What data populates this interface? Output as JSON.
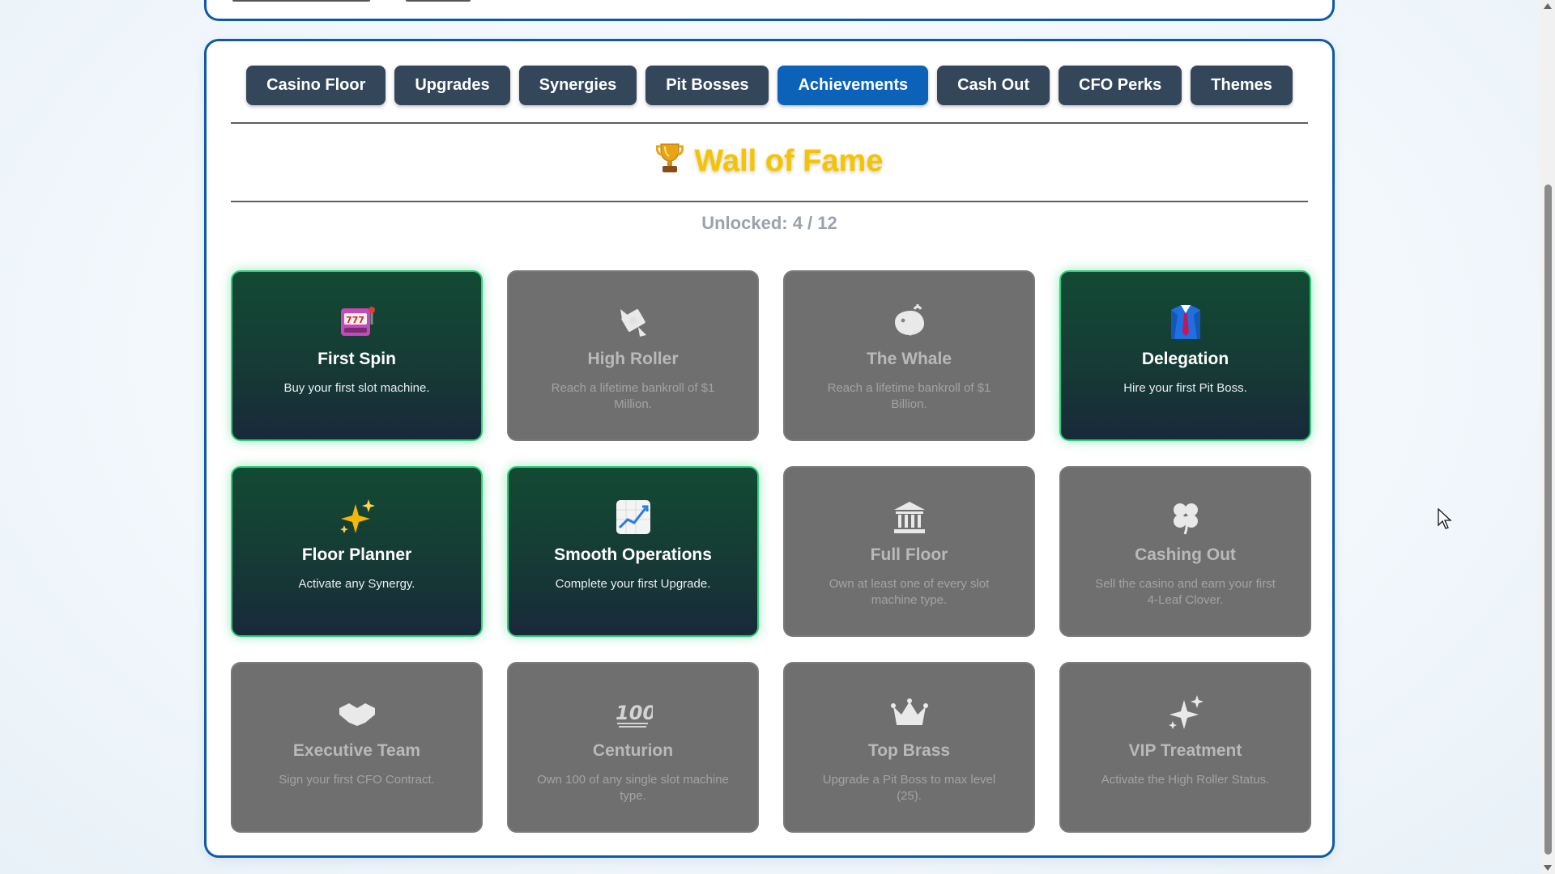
{
  "tabs": [
    {
      "label": "Casino Floor",
      "active": false
    },
    {
      "label": "Upgrades",
      "active": false
    },
    {
      "label": "Synergies",
      "active": false
    },
    {
      "label": "Pit Bosses",
      "active": false
    },
    {
      "label": "Achievements",
      "active": true
    },
    {
      "label": "Cash Out",
      "active": false
    },
    {
      "label": "CFO Perks",
      "active": false
    },
    {
      "label": "Themes",
      "active": false
    }
  ],
  "page": {
    "title": "Wall of Fame",
    "trophy_icon": "trophy-icon",
    "unlocked_text": "Unlocked: 4 / 12"
  },
  "achievements": [
    {
      "title": "First Spin",
      "desc": "Buy your first slot machine.",
      "unlocked": true,
      "icon": "slot-machine-icon"
    },
    {
      "title": "High Roller",
      "desc": "Reach a lifetime bankroll of $1 Million.",
      "unlocked": false,
      "icon": "money-wings-icon"
    },
    {
      "title": "The Whale",
      "desc": "Reach a lifetime bankroll of $1 Billion.",
      "unlocked": false,
      "icon": "whale-icon"
    },
    {
      "title": "Delegation",
      "desc": "Hire your first Pit Boss.",
      "unlocked": true,
      "icon": "suit-icon"
    },
    {
      "title": "Floor Planner",
      "desc": "Activate any Synergy.",
      "unlocked": true,
      "icon": "sparkles-icon"
    },
    {
      "title": "Smooth Operations",
      "desc": "Complete your first Upgrade.",
      "unlocked": true,
      "icon": "chart-up-icon"
    },
    {
      "title": "Full Floor",
      "desc": "Own at least one of every slot machine type.",
      "unlocked": false,
      "icon": "bank-icon"
    },
    {
      "title": "Cashing Out",
      "desc": "Sell the casino and earn your first 4-Leaf Clover.",
      "unlocked": false,
      "icon": "clover-icon"
    },
    {
      "title": "Executive Team",
      "desc": "Sign your first CFO Contract.",
      "unlocked": false,
      "icon": "handshake-icon"
    },
    {
      "title": "Centurion",
      "desc": "Own 100 of any single slot machine type.",
      "unlocked": false,
      "icon": "hundred-icon"
    },
    {
      "title": "Top Brass",
      "desc": "Upgrade a Pit Boss to max level (25).",
      "unlocked": false,
      "icon": "crown-icon"
    },
    {
      "title": "VIP Treatment",
      "desc": "Activate the High Roller Status.",
      "unlocked": false,
      "icon": "sparkles-icon"
    }
  ],
  "colors": {
    "panel_border": "#0f5aa8",
    "tab_bg": "#34475a",
    "tab_active_bg": "#0b62b8",
    "title_color": "#f5c400",
    "unlocked_glow": "#2ecf7a",
    "locked_bg": "#6f6f6f"
  }
}
